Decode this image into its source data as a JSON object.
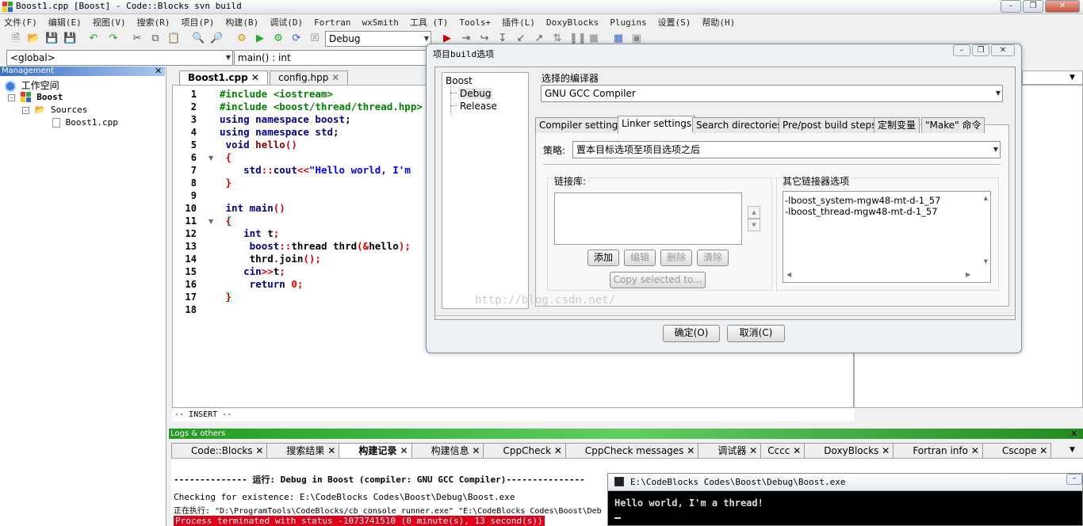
{
  "window": {
    "title": "Boost1.cpp [Boost] - Code::Blocks svn build"
  },
  "menu": [
    "文件(F)",
    "编辑(E)",
    "视图(V)",
    "搜索(R)",
    "项目(P)",
    "构建(B)",
    "调试(D)",
    "Fortran",
    "wxSmith",
    "工具 (T)",
    "Tools+",
    "插件(L)",
    "DoxyBlocks",
    "Plugins",
    "设置(S)",
    "帮助(H)"
  ],
  "toolbar": {
    "build_target": "Debug",
    "scope": "<global>",
    "function": "main() : int"
  },
  "management": {
    "title": "Management",
    "workspace": "工作空间",
    "project": "Boost",
    "folder": "Sources",
    "file": "Boost1.cpp"
  },
  "editor": {
    "tabs": [
      "Boost1.cpp",
      "config.hpp"
    ],
    "line_numbers": [
      "1",
      "2",
      "3",
      "4",
      "5",
      "6",
      "7",
      "8",
      "9",
      "10",
      "11",
      "12",
      "13",
      "14",
      "15",
      "16",
      "17",
      "18"
    ],
    "status": "-- INSERT --"
  },
  "dialog": {
    "title": "项目build选项",
    "targets": [
      "Boost",
      "Debug",
      "Release"
    ],
    "compiler_label": "选择的编译器",
    "compiler_value": "GNU GCC Compiler",
    "tabs": [
      "Compiler settings",
      "Linker settings",
      "Search directories",
      "Pre/post build steps",
      "定制变量",
      "\"Make\" 命令"
    ],
    "policy_label": "策略:",
    "policy_value": "置本目标选项至项目选项之后",
    "link_libs_label": "链接库:",
    "other_linker_label": "其它链接器选项",
    "other_linker_lines": [
      "-lboost_system-mgw48-mt-d-1_57",
      "-lboost_thread-mgw48-mt-d-1_57"
    ],
    "buttons": {
      "add": "添加",
      "edit": "编辑",
      "delete": "删除",
      "clear": "清除",
      "copy": "Copy selected to...",
      "ok": "确定(O)",
      "cancel": "取消(C)"
    },
    "watermark": "http://blog.csdn.net/"
  },
  "logs": {
    "title": "Logs & others",
    "tabs": [
      "Code::Blocks",
      "搜索结果",
      "构建记录",
      "构建信息",
      "CppCheck",
      "CppCheck messages",
      "调试器",
      "Cccc",
      "DoxyBlocks",
      "Fortran info",
      "Cscope"
    ],
    "line1": "-------------- 运行: Debug in Boost (compiler: GNU GCC Compiler)---------------",
    "line2": "Checking for existence: E:\\CodeBlocks Codes\\Boost\\Debug\\Boost.exe",
    "line3": "正在执行: \"D:\\ProgramTools\\CodeBlocks/cb_console_runner.exe\" \"E:\\CodeBlocks Codes\\Boost\\Deb",
    "line4": "Process terminated with status -1073741510 (0 minute(s), 13 second(s))"
  },
  "console": {
    "title": "E:\\CodeBlocks Codes\\Boost\\Debug\\Boost.exe",
    "output": "Hello world, I'm a thread!"
  }
}
